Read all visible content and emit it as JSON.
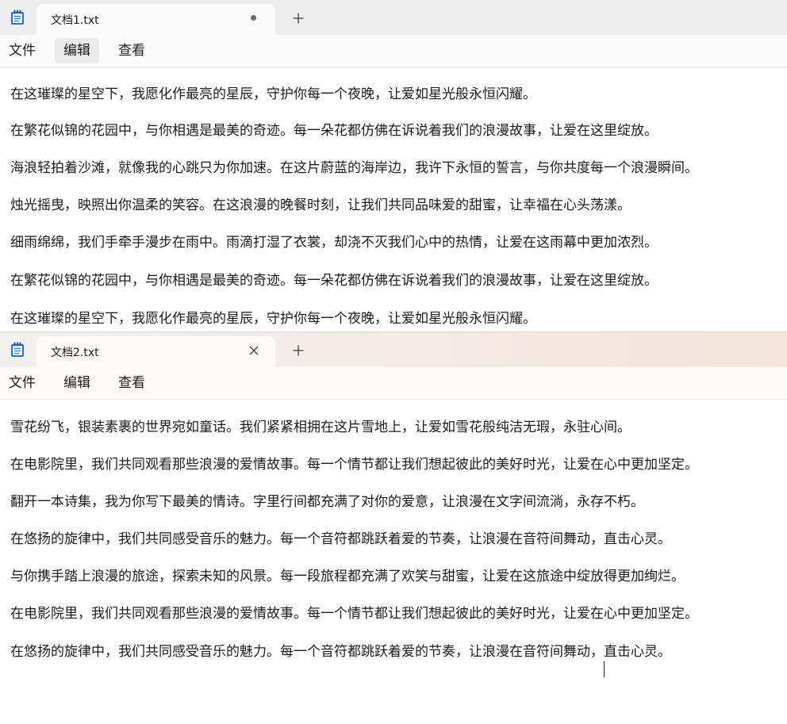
{
  "windows": [
    {
      "tab": {
        "title": "文档1.txt",
        "state_icon": "unsaved-dot-icon"
      },
      "menu": [
        {
          "label": "文件"
        },
        {
          "label": "编辑"
        },
        {
          "label": "查看"
        }
      ],
      "active_menu": "编辑",
      "lines": [
        "在这璀璨的星空下，我愿化作最亮的星辰，守护你每一个夜晚，让爱如星光般永恒闪耀。",
        "在繁花似锦的花园中，与你相遇是最美的奇迹。每一朵花都仿佛在诉说着我们的浪漫故事，让爱在这里绽放。",
        "海浪轻拍着沙滩，就像我的心跳只为你加速。在这片蔚蓝的海岸边，我许下永恒的誓言，与你共度每一个浪漫瞬间。",
        "烛光摇曳，映照出你温柔的笑容。在这浪漫的晚餐时刻，让我们共同品味爱的甜蜜，让幸福在心头荡漾。",
        "细雨绵绵，我们手牵手漫步在雨中。雨滴打湿了衣裳，却浇不灭我们心中的热情，让爱在这雨幕中更加浓烈。",
        "在繁花似锦的花园中，与你相遇是最美的奇迹。每一朵花都仿佛在诉说着我们的浪漫故事，让爱在这里绽放。",
        "在这璀璨的星空下，我愿化作最亮的星辰，守护你每一个夜晚，让爱如星光般永恒闪耀。"
      ]
    },
    {
      "tab": {
        "title": "文档2.txt",
        "state_icon": "close-icon"
      },
      "menu": [
        {
          "label": "文件"
        },
        {
          "label": "编辑"
        },
        {
          "label": "查看"
        }
      ],
      "lines": [
        "雪花纷飞，银装素裹的世界宛如童话。我们紧紧相拥在这片雪地上，让爱如雪花般纯洁无瑕，永驻心间。",
        "在电影院里，我们共同观看那些浪漫的爱情故事。每一个情节都让我们想起彼此的美好时光，让爱在心中更加坚定。",
        "翻开一本诗集，我为你写下最美的情诗。字里行间都充满了对你的爱意，让浪漫在文字间流淌，永存不朽。",
        "在悠扬的旋律中，我们共同感受音乐的魅力。每一个音符都跳跃着爱的节奏，让浪漫在音符间舞动，直击心灵。",
        "与你携手踏上浪漫的旅途，探索未知的风景。每一段旅程都充满了欢笑与甜蜜，让爱在这旅途中绽放得更加绚烂。",
        "在电影院里，我们共同观看那些浪漫的爱情故事。每一个情节都让我们想起彼此的美好时光，让爱在心中更加坚定。",
        "在悠扬的旋律中，我们共同感受音乐的魅力。每一个音符都跳跃着爱的节奏，让浪漫在音符间舞动，直击心灵。"
      ]
    }
  ],
  "colors": {
    "accent": "#2b6fd6",
    "text": "#1b1b1b",
    "tab_bg": "#fbfbfb",
    "titlebar_bg": "#ededed"
  },
  "icons": {
    "app": "notepad-icon",
    "new_tab": "plus-icon"
  }
}
